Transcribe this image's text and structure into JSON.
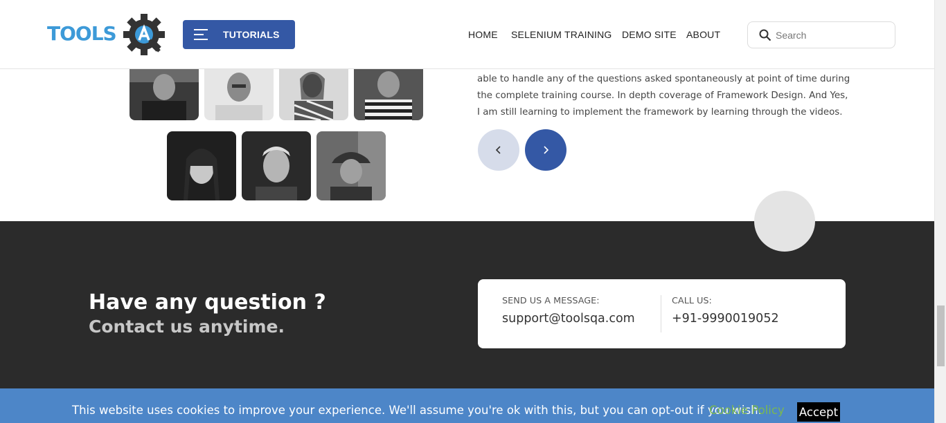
{
  "header": {
    "logo_text": "TOOLSQA",
    "tutorials_label": "TUTORIALS",
    "nav": [
      "HOME",
      "SELENIUM TRAINING",
      "DEMO SITE",
      "ABOUT"
    ],
    "search_placeholder": "Search"
  },
  "testimonial": {
    "text": "able to handle any of the questions asked spontaneously at point of time during the complete training course. In depth coverage of Framework Design. And Yes, I am still learning to implement the framework by learning through the videos.",
    "prev_icon": "chevron-left-icon",
    "next_icon": "chevron-right-icon"
  },
  "footer": {
    "heading": "Have any question ?",
    "subheading": "Contact us anytime.",
    "message_label": "SEND US A MESSAGE:",
    "email": "support@toolsqa.com",
    "call_label": "CALL US:",
    "phone": "+91-9990019052"
  },
  "cookie": {
    "message": "This website uses cookies to improve your experience. We'll assume you're ok with this, but you can opt-out if you wish.",
    "policy_label": "Cookie Policy",
    "accept_label": "Accept"
  },
  "colors": {
    "brand_blue": "#3458a5",
    "logo_blue": "#3d9ad8",
    "footer_bg": "#2b2b2b",
    "cookie_bg": "#4d86c8",
    "policy_green": "#7ab851"
  }
}
